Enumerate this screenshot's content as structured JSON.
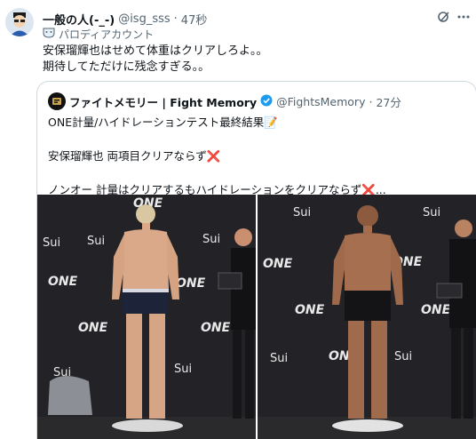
{
  "tweet": {
    "display_name": "一般の人(-_-)",
    "handle": "@isg_sss",
    "time": "47秒",
    "parody_label": "パロディアカウント",
    "text": "安保瑠輝也はせめて体重はクリアしろよ。。\n期待してただけに残念すぎる。。"
  },
  "quote": {
    "display_name": "ファイトメモリー | Fight Memory",
    "handle": "@FightsMemory",
    "time": "27分",
    "line1": "ONE計量/ハイドレーションテスト最終結果📝",
    "line2": "安保瑠輝也 両項目クリアならず",
    "line3": "ノンオー 計量はクリアするもハイドレーションをクリアならず",
    "line3_suffix": "...",
    "x_mark": "❌"
  },
  "banner": {
    "brand_one": "ONE",
    "brand_sui": "Sui"
  },
  "colors": {
    "verified": "#1d9bf0",
    "muted": "#536471",
    "border": "#cfd9de"
  }
}
